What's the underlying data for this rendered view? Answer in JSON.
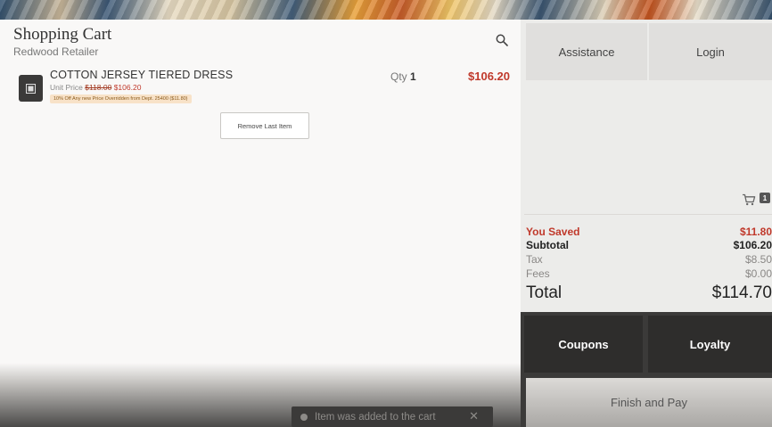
{
  "cart": {
    "title": "Shopping Cart",
    "store": "Redwood Retailer",
    "items": [
      {
        "name": "COTTON JERSEY TIERED DRESS",
        "unit_price_label": "Unit Price",
        "original_price": "$118.00",
        "sale_price": "$106.20",
        "discount_note": "10% Off Any new Price Overridden from Dept. 25400 ($11.80)",
        "qty_label": "Qty",
        "qty": "1",
        "line_total": "$106.20"
      }
    ],
    "remove_last_label": "Remove Last Item"
  },
  "toast": {
    "message": "Item was added to the cart",
    "close": "✕"
  },
  "side": {
    "assistance_label": "Assistance",
    "login_label": "Login",
    "cart_count": "1"
  },
  "totals": {
    "saved_label": "You Saved",
    "saved": "$11.80",
    "subtotal_label": "Subtotal",
    "subtotal": "$106.20",
    "tax_label": "Tax",
    "tax": "$8.50",
    "fees_label": "Fees",
    "fees": "$0.00",
    "total_label": "Total",
    "total": "$114.70"
  },
  "actions": {
    "coupons_label": "Coupons",
    "loyalty_label": "Loyalty",
    "finish_label": "Finish and Pay"
  },
  "colors": {
    "accent_red": "#c0392b",
    "dark": "#3b3a39",
    "panel": "#ececea"
  }
}
